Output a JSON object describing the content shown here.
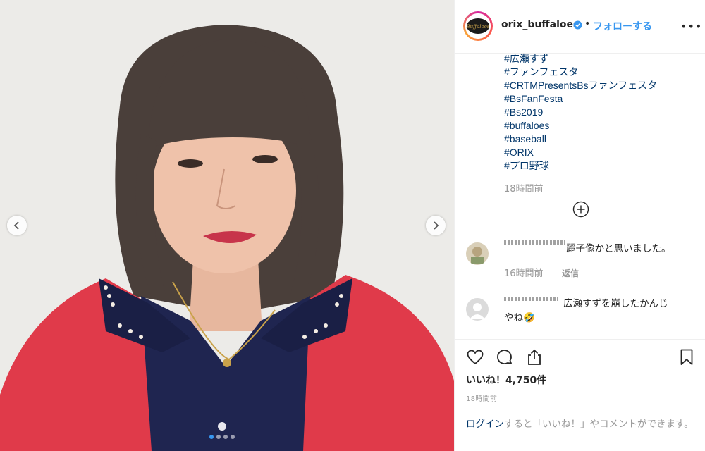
{
  "post": {
    "username": "orix_buffaloes",
    "separator": "•",
    "follow_label": "フォローする",
    "more_label": "•••",
    "avatar_text": "Buffaloes",
    "hashtags": [
      "#広瀬すず",
      "#ファンフェスタ",
      "#CRTMPresentsBsファンフェスタ",
      "#BsFanFesta",
      "#Bs2019",
      "#buffaloes",
      "#baseball",
      "#ORIX",
      "#プロ野球"
    ],
    "caption_time": "18時間前"
  },
  "comments": [
    {
      "text": "麗子像かと思いました。",
      "time": "16時間前",
      "reply_label": "返信"
    },
    {
      "text_line1": "広瀬すずを崩したかんじ",
      "text_line2": "やね🤣"
    }
  ],
  "footer": {
    "likes": "いいね！4,750件",
    "time": "18時間前",
    "login_link": "ログイン",
    "login_rest": "すると「いいね！」やコメントができます。"
  },
  "carousel": {
    "current": 1,
    "total": 4
  },
  "colors": {
    "link": "#003569",
    "accent": "#3897f0",
    "jacket": "#e03a4a",
    "shirt": "#1f2550"
  }
}
